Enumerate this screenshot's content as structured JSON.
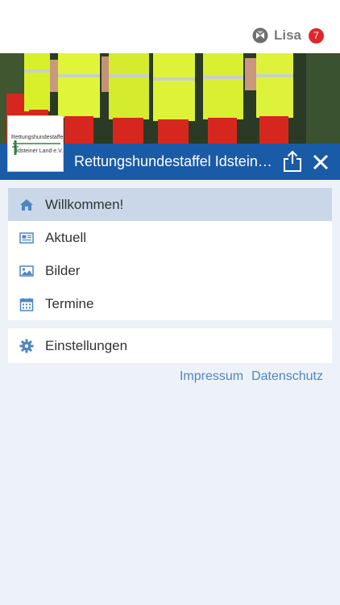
{
  "header": {
    "user_name": "Lisa",
    "notification_count": "7"
  },
  "org": {
    "name": "Rettungshundestaffel Idsteiner Land e.V.",
    "logo_line1": "Rettungshundestaffel",
    "logo_line2": "Idsteiner Land e.V."
  },
  "menu": {
    "items": [
      {
        "label": "Willkommen!",
        "icon": "home-icon",
        "active": true
      },
      {
        "label": "Aktuell",
        "icon": "newspaper-icon",
        "active": false
      },
      {
        "label": "Bilder",
        "icon": "image-icon",
        "active": false
      },
      {
        "label": "Termine",
        "icon": "calendar-icon",
        "active": false
      }
    ],
    "settings": {
      "label": "Einstellungen",
      "icon": "gear-icon"
    }
  },
  "footer_links": {
    "impressum": "Impressum",
    "datenschutz": "Datenschutz"
  },
  "colors": {
    "brand_blue": "#1a5ba8",
    "accent_link": "#4f86c2",
    "badge_red": "#e0262b",
    "active_row": "#c9d7e8"
  }
}
